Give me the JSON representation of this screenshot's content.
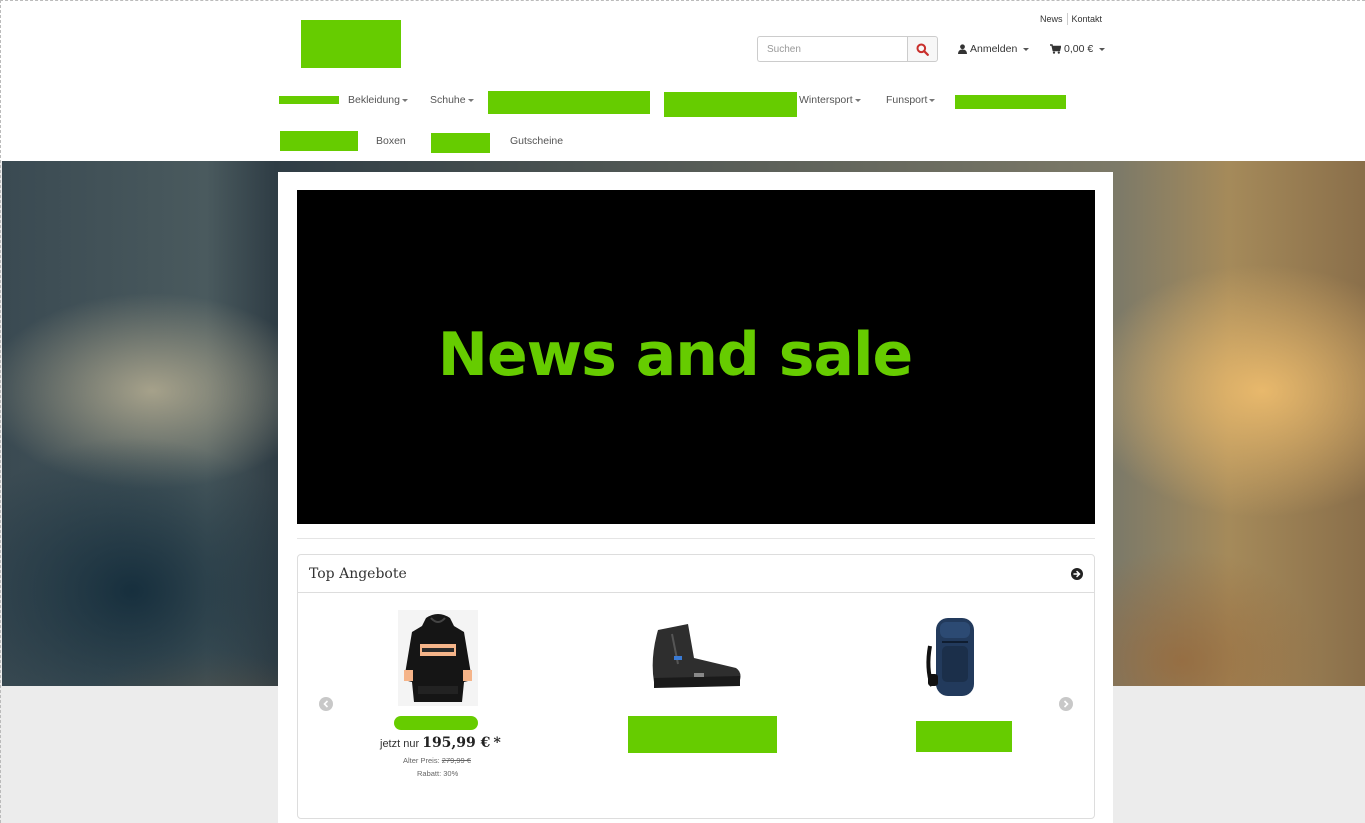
{
  "header": {
    "top_links": [
      "News",
      "Kontakt"
    ],
    "search": {
      "placeholder": "Suchen",
      "icon": "search-icon"
    },
    "account_label": "Anmelden",
    "cart_total": "0,00 €"
  },
  "nav": {
    "items": [
      {
        "label": "Bekleidung",
        "dropdown": true
      },
      {
        "label": "Schuhe",
        "dropdown": true
      },
      {
        "label": "Wintersport",
        "dropdown": true
      },
      {
        "label": "Funsport",
        "dropdown": true
      },
      {
        "label": "Boxen",
        "dropdown": false
      },
      {
        "label": "Gutscheine",
        "dropdown": false
      }
    ]
  },
  "banner": {
    "text": "News and sale"
  },
  "top_offers": {
    "title": "Top Angebote",
    "products": [
      {
        "image": "jacket",
        "price_prefix": "jetzt nur",
        "price": "195,99 €",
        "price_suffix": "*",
        "old_price_label": "Alter Preis:",
        "old_price": "279,99 €",
        "discount": "Rabatt: 30%"
      },
      {
        "image": "hiking-boot"
      },
      {
        "image": "backpack"
      }
    ]
  },
  "colors": {
    "redaction": "#66cc00",
    "banner_bg": "#000000",
    "search_icon": "#c9302c"
  }
}
